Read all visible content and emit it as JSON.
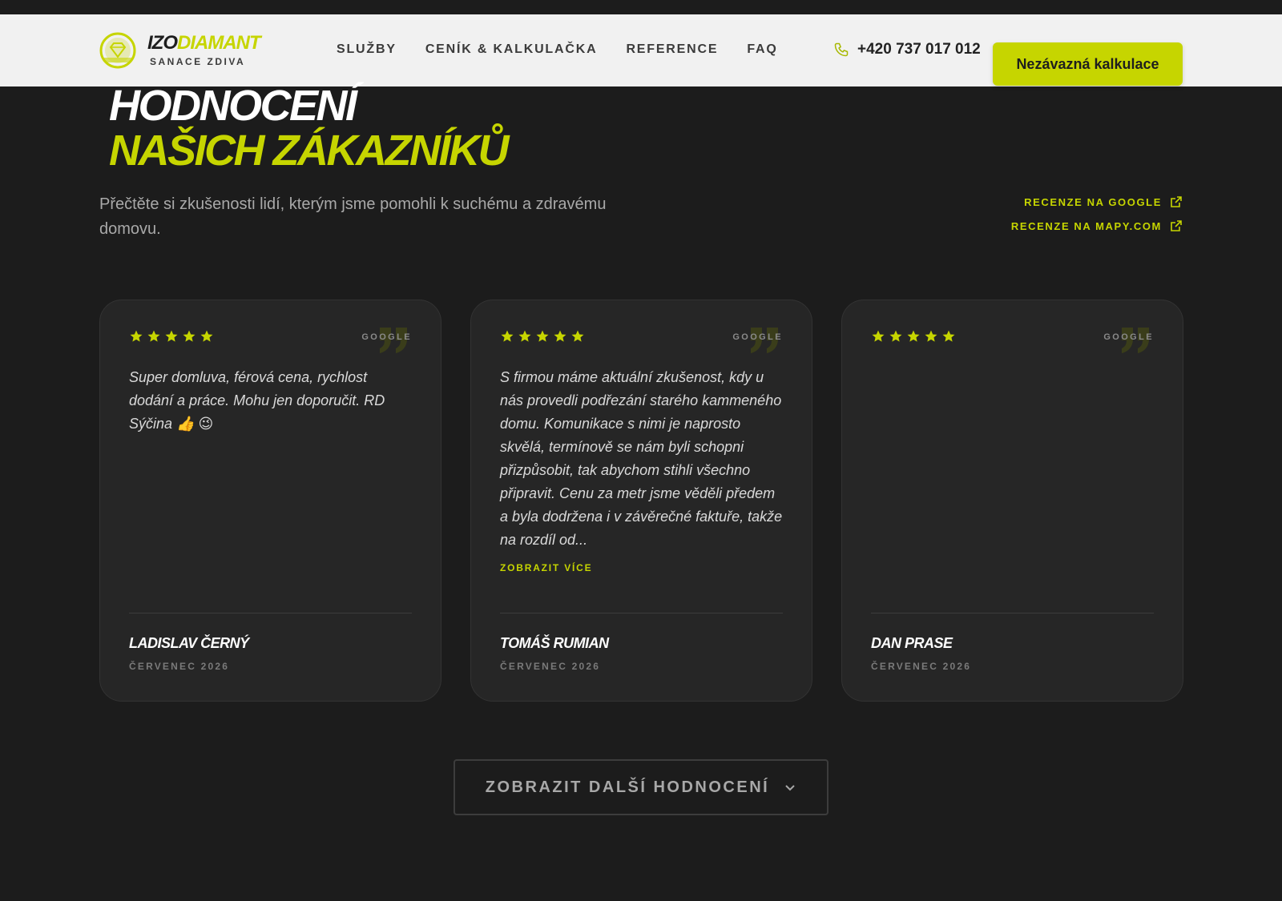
{
  "header": {
    "logo_name_a": "IZO",
    "logo_name_b": "DIAMANT",
    "logo_sub": "SANACE ZDIVA",
    "nav": [
      "SLUŽBY",
      "CENÍK & KALKULAČKA",
      "REFERENCE",
      "FAQ"
    ],
    "phone": "+420 737 017 012",
    "cta": "Nezávazná kalkulace"
  },
  "hero": {
    "title_line1": "HODNOCENÍ",
    "title_line2": "NAŠICH ZÁKAZNÍKŮ",
    "intro": "Přečtěte si zkušenosti lidí, kterým jsme pomohli k suchému a zdravému domovu.",
    "links": [
      "RECENZE NA GOOGLE",
      "RECENZE NA MAPY.COM"
    ]
  },
  "reviews": [
    {
      "rating": 5,
      "source": "GOOGLE",
      "text": "Super domluva, férová cena, rychlost dodání a práce. Mohu jen doporučit. RD Sýčina 👍 😉",
      "more": "",
      "author": "LADISLAV ČERNÝ",
      "date": "ČERVENEC 2026"
    },
    {
      "rating": 5,
      "source": "GOOGLE",
      "text": "S firmou máme aktuální zkušenost, kdy u nás provedli podřezání starého kammeného domu. Komunikace s nimi je naprosto skvělá, termínově se nám byli schopni přizpůsobit, tak abychom stihli všechno připravit. Cenu za metr jsme věděli předem a byla dodržena i v závěrečné faktuře, takže na rozdíl od...",
      "more": "ZOBRAZIT VÍCE",
      "author": "TOMÁŠ RUMIAN",
      "date": "ČERVENEC 2026"
    },
    {
      "rating": 5,
      "source": "GOOGLE",
      "text": "",
      "more": "",
      "author": "DAN PRASE",
      "date": "ČERVENEC 2026"
    }
  ],
  "load_more": "ZOBRAZIT DALŠÍ HODNOCENÍ",
  "colors": {
    "accent": "#c6d500",
    "background": "#1c1c1c",
    "card": "#262626",
    "header": "#f1f1f1"
  }
}
